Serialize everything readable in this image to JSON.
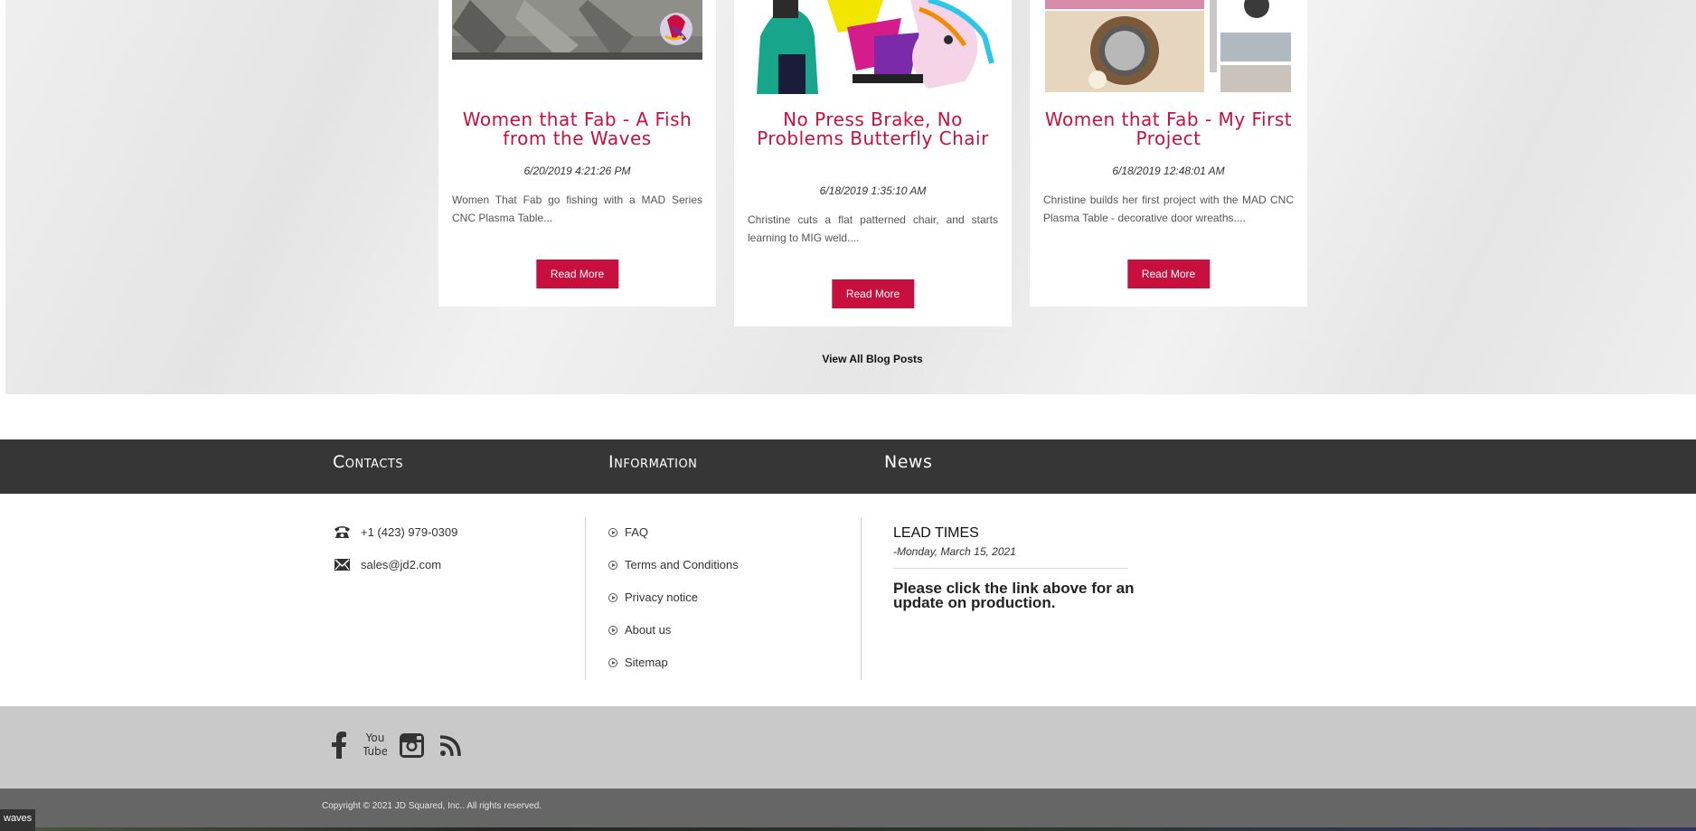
{
  "blog": {
    "posts": [
      {
        "title": "Women that Fab - A Fish from the Waves",
        "date": "6/20/2019 4:21:26 PM",
        "excerpt": "Women That Fab go fishing with a MAD Series CNC Plasma Table...",
        "button": "Read More"
      },
      {
        "title": "No Press Brake, No Problems Butterfly Chair",
        "date": "6/18/2019 1:35:10 AM",
        "excerpt": "Christine cuts a flat patterned chair, and starts learning to MIG weld....",
        "button": "Read More"
      },
      {
        "title": "Women that Fab - My First Project",
        "date": "6/18/2019 12:48:01 AM",
        "excerpt": "Christine builds her first project with the MAD CNC Plasma Table - decorative door wreaths....",
        "button": "Read More"
      }
    ],
    "view_all": "View All Blog Posts"
  },
  "footer": {
    "headings": {
      "contacts": "Contacts",
      "information": "Information",
      "news": "News"
    },
    "contacts": {
      "phone": "+1 (423) 979-0309",
      "email": "sales@jd2.com"
    },
    "information": [
      "FAQ",
      "Terms and Conditions",
      "Privacy notice",
      "About us",
      "Sitemap"
    ],
    "news": {
      "title": "LEAD TIMES",
      "date": "-Monday, March 15, 2021",
      "body": "Please click the link above for an update on production."
    },
    "social_icons": [
      "facebook-icon",
      "youtube-icon",
      "instagram-icon",
      "rss-icon"
    ],
    "copyright": "Copyright © 2021 JD Squared, Inc.. All rights reserved.",
    "tooltip": "waves"
  },
  "colors": {
    "accent": "#c8103e",
    "footer_dark": "#363636",
    "social_band": "#c9c9c9",
    "copyright_band": "#666666"
  }
}
